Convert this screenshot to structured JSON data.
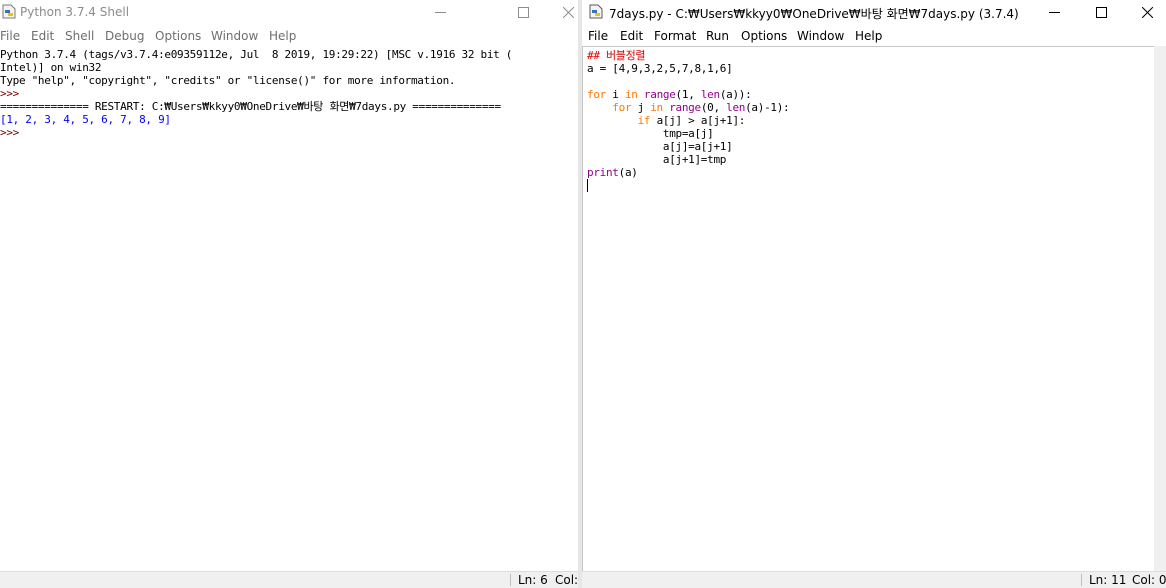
{
  "shell": {
    "title": "Python 3.7.4 Shell",
    "menu": [
      "File",
      "Edit",
      "Shell",
      "Debug",
      "Options",
      "Window",
      "Help"
    ],
    "lines": [
      "Python 3.7.4 (tags/v3.7.4:e09359112e, Jul  8 2019, 19:29:22) [MSC v.1916 32 bit (",
      "Intel)] on win32",
      "Type \"help\", \"copyright\", \"credits\" or \"license()\" for more information.",
      ">>> ",
      "============== RESTART: C:₩Users₩kkyy0₩OneDrive₩바탕 화면₩7days.py ==============",
      "[1, 2, 3, 4, 5, 6, 7, 8, 9]",
      ">>> "
    ],
    "status": {
      "ln": "Ln: 6",
      "col": "Col:"
    }
  },
  "editor": {
    "title": "7days.py - C:₩Users₩kkyy0₩OneDrive₩바탕 화면₩7days.py (3.7.4)",
    "menu": [
      "File",
      "Edit",
      "Format",
      "Run",
      "Options",
      "Window",
      "Help"
    ],
    "code": [
      "## 버블정렬",
      "a = [4,9,3,2,5,7,8,1,6]",
      "",
      "for i in range(1, len(a)):",
      "    for j in range(0, len(a)-1):",
      "        if a[j] > a[j+1]:",
      "            tmp=a[j]",
      "            a[j]=a[j+1]",
      "            a[j+1]=tmp",
      "print(a)",
      ""
    ],
    "tokens": {
      "l3_for": "for",
      "l3_a": " i ",
      "l3_in": "in",
      "l3_b": " ",
      "l3_range": "range",
      "l3_c": "(1, ",
      "l3_len": "len",
      "l3_d": "(a)):",
      "l4_pre": "    ",
      "l4_for": "for",
      "l4_a": " j ",
      "l4_in": "in",
      "l4_b": " ",
      "l4_range": "range",
      "l4_c": "(0, ",
      "l4_len": "len",
      "l4_d": "(a)-1):",
      "l5_pre": "        ",
      "l5_if": "if",
      "l5_a": " a[j] > a[j+1]:",
      "l9_print": "print",
      "l9_a": "(a)"
    },
    "status": {
      "ln": "Ln: 11",
      "col": "Col: 0"
    }
  },
  "colors": {
    "keyword": "#ff7700",
    "builtin": "#900090",
    "comment": "#dd0000",
    "output": "#0000ff",
    "prompt": "#770000"
  }
}
